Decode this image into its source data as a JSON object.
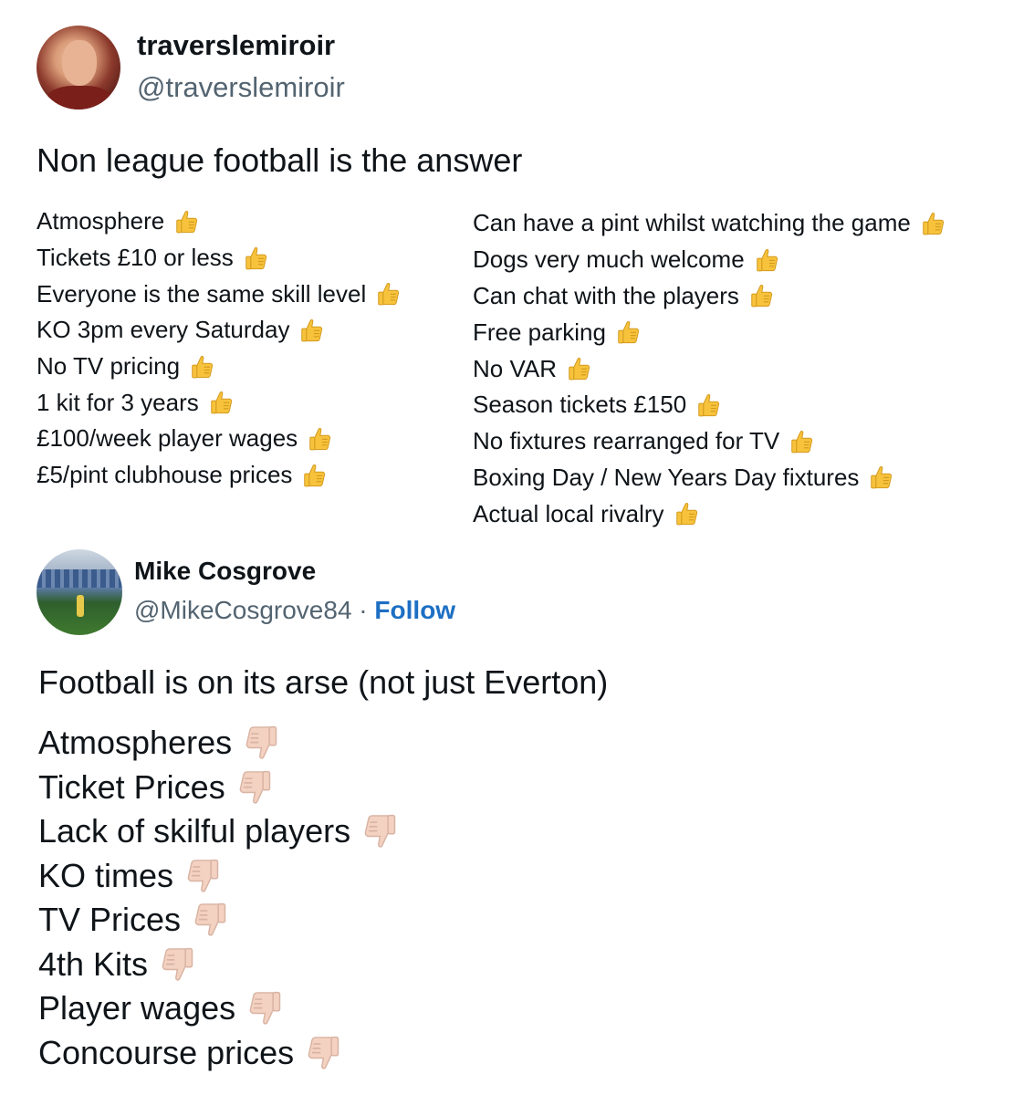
{
  "tweet1": {
    "display_name": "traverslemiroir",
    "handle": "@traverslemiroir",
    "text": "Non league football is the answer",
    "list_left": [
      "Atmosphere",
      "Tickets £10 or less",
      "Everyone is the same skill level",
      "KO 3pm every Saturday",
      "No TV pricing",
      "1 kit for 3 years",
      "£100/week player wages",
      "£5/pint clubhouse prices"
    ],
    "list_right": [
      "Can have a pint whilst watching the game",
      "Dogs very much welcome",
      "Can chat with the players",
      "Free parking",
      "No VAR",
      "Season tickets £150",
      "No fixtures rearranged for TV",
      "Boxing Day / New Years Day fixtures",
      "Actual local rivalry"
    ],
    "item_icon": "thumbs-up-icon"
  },
  "tweet2": {
    "display_name": "Mike Cosgrove",
    "handle": "@MikeCosgrove84",
    "separator": " · ",
    "follow_label": "Follow",
    "text": "Football is on its arse (not just Everton)",
    "list": [
      "Atmospheres",
      "Ticket Prices",
      "Lack of skilful players",
      "KO times",
      "TV Prices",
      "4th Kits",
      "Player wages",
      "Concourse prices"
    ],
    "item_icon": "thumbs-down-icon"
  },
  "colors": {
    "text": "#0f1419",
    "secondary_text": "#536471",
    "follow_link": "#1d6fc4",
    "thumbs_up": "#f7c33c",
    "thumbs_down": "#f3d2c2"
  }
}
